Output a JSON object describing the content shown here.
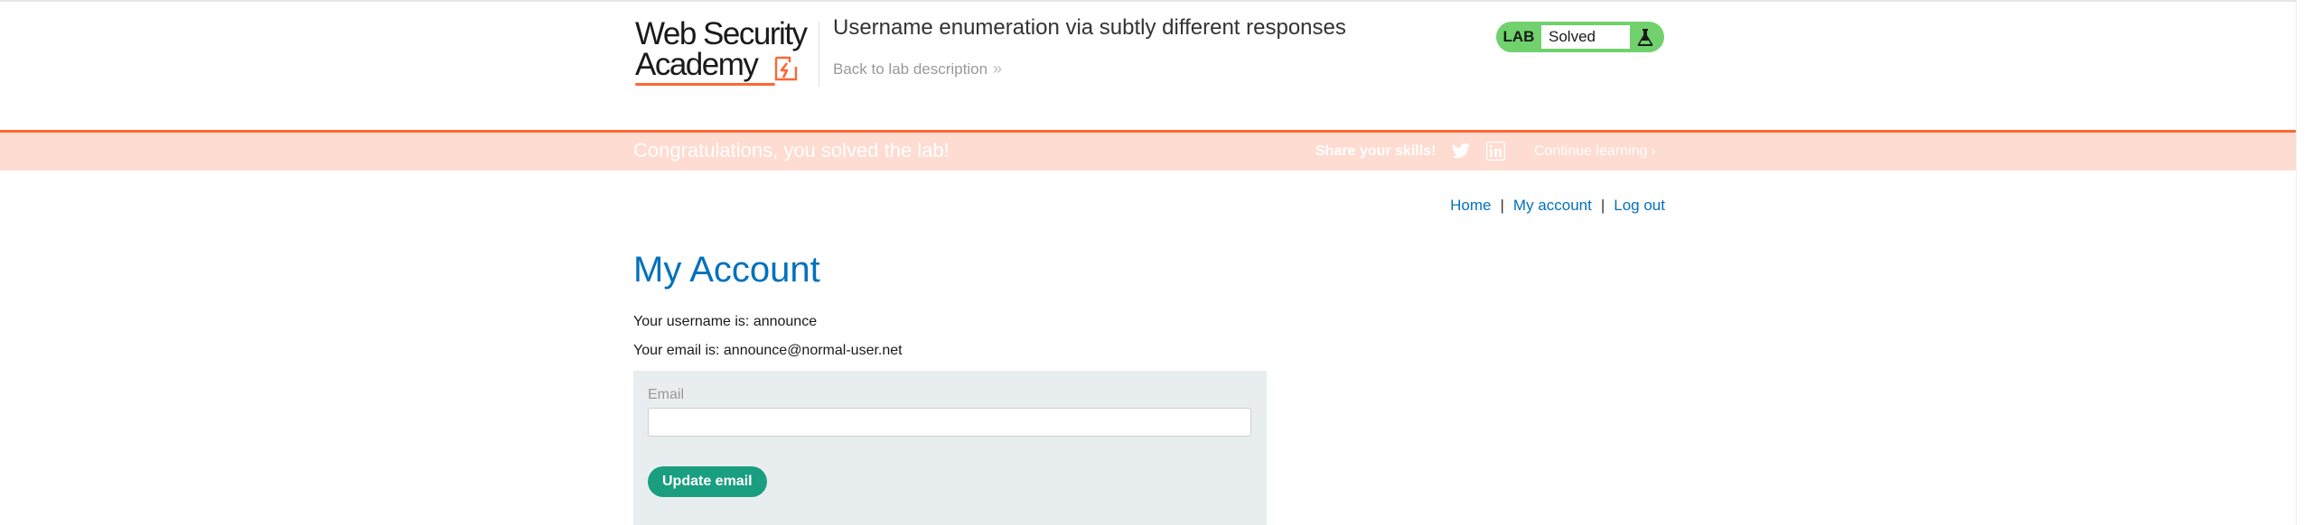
{
  "header": {
    "logo": {
      "line1": "Web Security",
      "line2": "Academy"
    },
    "lab_title": "Username enumeration via subtly different responses",
    "back_link": "Back to lab description",
    "back_chevron": "»",
    "lab_status": {
      "tag": "LAB",
      "status": "Solved"
    }
  },
  "banner": {
    "message": "Congratulations, you solved the lab!",
    "share_label": "Share your skills!",
    "continue_link": "Continue learning",
    "continue_chevron": "›"
  },
  "nav": {
    "home": "Home",
    "my_account": "My account",
    "log_out": "Log out",
    "separator": "|"
  },
  "account": {
    "title": "My Account",
    "username_text": "Your username is: announce",
    "email_text": "Your email is: announce@normal-user.net"
  },
  "form": {
    "email_label": "Email",
    "email_value": "",
    "update_button": "Update email"
  },
  "icons": {
    "logo_bolt": "lightning-bolt-icon",
    "flask": "flask-icon",
    "twitter": "twitter-icon",
    "linkedin": "linkedin-icon"
  },
  "colors": {
    "accent": "#ff6633",
    "link": "#0071bc",
    "banner_bg": "#ffdcd1",
    "lab_solved_green": "#70d16d",
    "button_green": "#1a9e80",
    "form_bg": "#e8eef0"
  }
}
